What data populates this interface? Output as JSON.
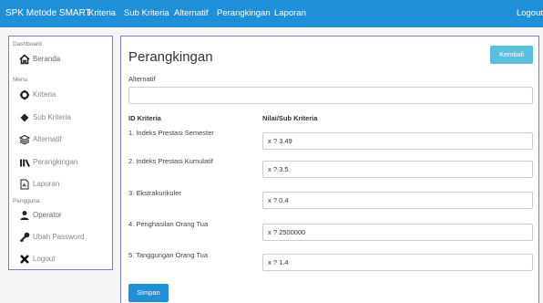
{
  "navbar": {
    "brand": "SPK Metode SMART",
    "links": [
      "Kriteria",
      "Sub Kriteria",
      "Alternatif",
      "Perangkingan",
      "Laporan"
    ],
    "logout": "Logout"
  },
  "sidebar": {
    "section_dashboard": "Dashboard",
    "section_menu": "Menu",
    "section_pengguna": "Pengguna",
    "items": [
      {
        "label": "Beranda",
        "icon": "home-icon"
      },
      {
        "label": "Kriteria",
        "icon": "gear-icon"
      },
      {
        "label": "Sub Kriteria",
        "icon": "diamond-icon"
      },
      {
        "label": "Alternatif",
        "icon": "layers-icon"
      },
      {
        "label": "Perangkingan",
        "icon": "ranking-icon"
      },
      {
        "label": "Laporan",
        "icon": "document-icon"
      },
      {
        "label": "Operator",
        "icon": "user-icon"
      },
      {
        "label": "Ubah Password",
        "icon": "key-icon"
      },
      {
        "label": "Logout",
        "icon": "close-icon"
      }
    ]
  },
  "main": {
    "title": "Perangkingan",
    "back_button": "Kembali",
    "alternatif_label": "Alternatif",
    "alternatif_value": "",
    "col_kriteria": "ID Kriteria",
    "col_nilai": "Nilai/Sub Kriteria",
    "criteria": [
      {
        "label": "1. Indeks Prestasi Semester",
        "value": "x ? 3.49"
      },
      {
        "label": "2. Indeks Prestasi Kumulatif",
        "value": "x ? 3.5"
      },
      {
        "label": "3. Ekstrakurikuler",
        "value": "x ? 0.4"
      },
      {
        "label": "4. Penghasilan Orang Tua",
        "value": "x ? 2500000"
      },
      {
        "label": "5. Tanggungan Orang Tua",
        "value": "x ? 1.4"
      }
    ],
    "save_button": "Simpan"
  }
}
